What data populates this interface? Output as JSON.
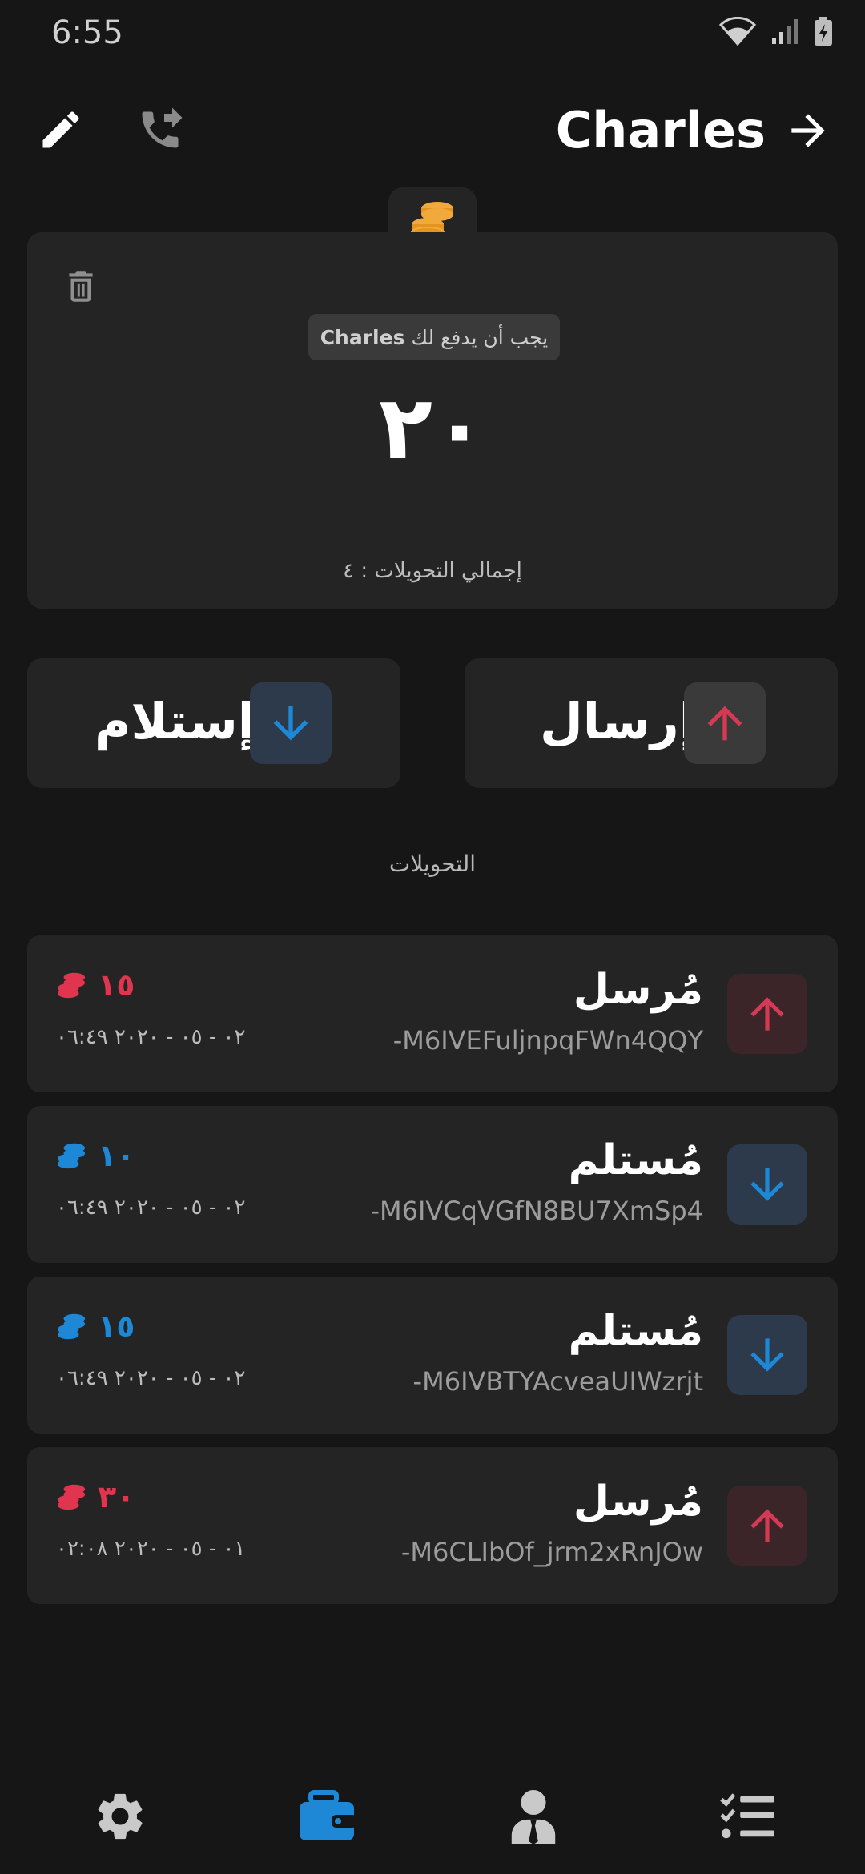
{
  "status_bar": {
    "time": "6:55"
  },
  "header": {
    "title": "Charles"
  },
  "summary": {
    "owe_text": "يجب أن يدفع لك",
    "owe_name": "Charles",
    "balance": "٢٠",
    "total_transfers": "إجمالي التحويلات : ٤"
  },
  "actions": {
    "send_label": "إرسال",
    "receive_label": "إستلام"
  },
  "section_title": "التحويلات",
  "transactions": [
    {
      "type": "مُرسل",
      "id": "-M6IVEFuljnpqFWn4QQY",
      "amount": "١٥",
      "date": "٠٢ - ٠٥ - ٢٠٢٠ ٠٦:٤٩",
      "direction": "sent",
      "color": "#e0344f"
    },
    {
      "type": "مُستلم",
      "id": "-M6IVCqVGfN8BU7XmSp4",
      "amount": "١٠",
      "date": "٠٢ - ٠٥ - ٢٠٢٠ ٠٦:٤٩",
      "direction": "received",
      "color": "#1e88d6"
    },
    {
      "type": "مُستلم",
      "id": "-M6IVBTYAcveaUIWzrjt",
      "amount": "١٥",
      "date": "٠٢ - ٠٥ - ٢٠٢٠ ٠٦:٤٩",
      "direction": "received",
      "color": "#1e88d6"
    },
    {
      "type": "مُرسل",
      "id": "-M6CLIbOf_jrm2xRnJOw",
      "amount": "٣٠",
      "date": "٠١ - ٠٥ - ٢٠٢٠ ٠٢:٠٨",
      "direction": "sent",
      "color": "#e0344f"
    }
  ],
  "colors": {
    "accent_blue": "#1e88d6",
    "accent_red": "#e0344f",
    "coin_gold": "#f2a93b",
    "card_bg": "#242424",
    "page_bg": "#161616"
  },
  "nav": {
    "active": "wallet-icon"
  }
}
